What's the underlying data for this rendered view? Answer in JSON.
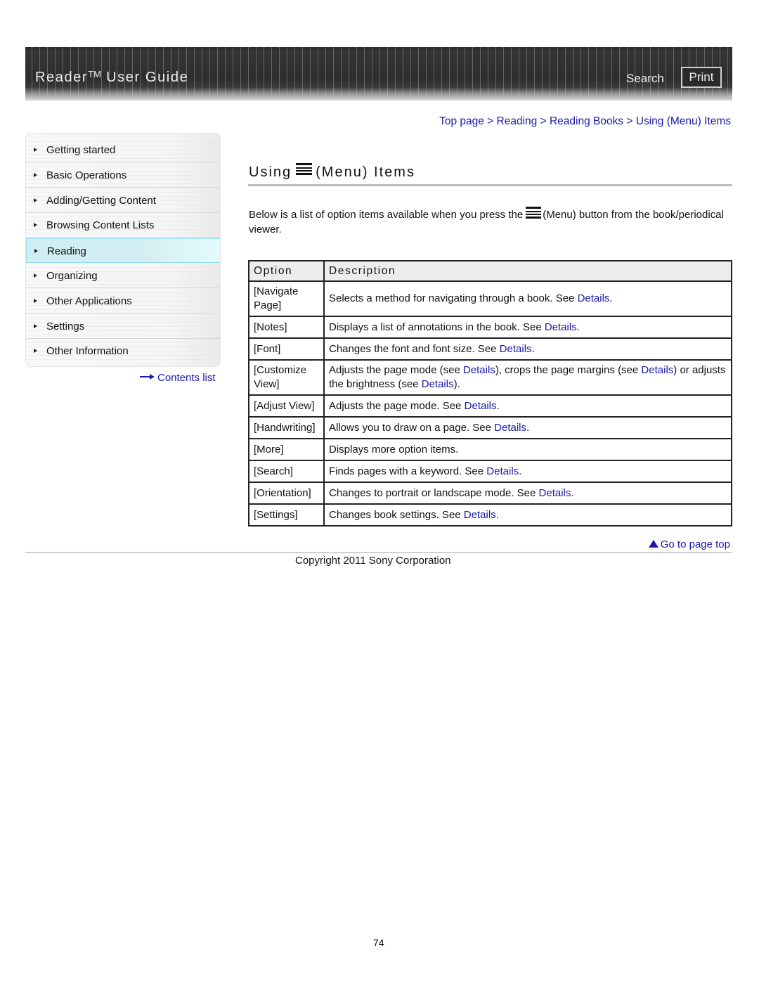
{
  "header": {
    "title": "Reader",
    "trademark": "TM",
    "title_suffix": " User Guide",
    "search_label": "Search",
    "print_label": "Print"
  },
  "sidebar": {
    "items": [
      {
        "label": "Getting started",
        "active": false
      },
      {
        "label": "Basic Operations",
        "active": false
      },
      {
        "label": "Adding/Getting Content",
        "active": false
      },
      {
        "label": "Browsing Content Lists",
        "active": false
      },
      {
        "label": "Reading",
        "active": true
      },
      {
        "label": "Organizing",
        "active": false
      },
      {
        "label": "Other Applications",
        "active": false
      },
      {
        "label": "Settings",
        "active": false
      },
      {
        "label": "Other Information",
        "active": false
      }
    ],
    "contents_list_label": "Contents list"
  },
  "breadcrumb": {
    "items": [
      "Top page",
      "Reading",
      "Reading Books",
      "Using (Menu) Items"
    ],
    "separator": " > "
  },
  "page": {
    "title_prefix": "Using",
    "title_suffix": "(Menu) Items",
    "intro_before_icon": "Below is a list of option items available when you press the",
    "intro_after_icon": "(Menu) button from the book/periodical viewer."
  },
  "table": {
    "headers": [
      "Option",
      "Description"
    ],
    "link_text": "Details",
    "rows": [
      {
        "option": "[Navigate Page]",
        "parts": [
          {
            "t": "Selects a method for navigating through a book. See "
          },
          {
            "link": "Details"
          },
          {
            "t": "."
          }
        ]
      },
      {
        "option": "[Notes]",
        "parts": [
          {
            "t": "Displays a list of annotations in the book. See "
          },
          {
            "link": "Details"
          },
          {
            "t": "."
          }
        ]
      },
      {
        "option": "[Font]",
        "parts": [
          {
            "t": "Changes the font and font size. See "
          },
          {
            "link": "Details"
          },
          {
            "t": "."
          }
        ]
      },
      {
        "option": "[Customize View]",
        "parts": [
          {
            "t": "Adjusts the page mode (see "
          },
          {
            "link": "Details"
          },
          {
            "t": "), crops the page margins (see "
          },
          {
            "link": "Details"
          },
          {
            "t": ") or adjusts the brightness (see "
          },
          {
            "link": "Details"
          },
          {
            "t": ")."
          }
        ]
      },
      {
        "option": "[Adjust View]",
        "parts": [
          {
            "t": "Adjusts the page mode. See "
          },
          {
            "link": "Details"
          },
          {
            "t": "."
          }
        ]
      },
      {
        "option": "[Handwriting]",
        "parts": [
          {
            "t": "Allows you to draw on a page. See "
          },
          {
            "link": "Details"
          },
          {
            "t": "."
          }
        ]
      },
      {
        "option": "[More]",
        "parts": [
          {
            "t": "Displays more option items."
          }
        ]
      },
      {
        "option": "[Search]",
        "parts": [
          {
            "t": "Finds pages with a keyword. See "
          },
          {
            "link": "Details"
          },
          {
            "t": "."
          }
        ]
      },
      {
        "option": "[Orientation]",
        "parts": [
          {
            "t": "Changes to portrait or landscape mode. See "
          },
          {
            "link": "Details"
          },
          {
            "t": "."
          }
        ]
      },
      {
        "option": "[Settings]",
        "parts": [
          {
            "t": "Changes book settings. See "
          },
          {
            "link": "Details"
          },
          {
            "t": "."
          }
        ]
      }
    ]
  },
  "footer": {
    "go_to_top_label": "Go to page top",
    "copyright": "Copyright 2011 Sony Corporation",
    "page_number": "74"
  },
  "colors": {
    "link": "#1a1aa6",
    "active_nav": "#d3eef2",
    "header_bg": "#2e2e2e"
  }
}
